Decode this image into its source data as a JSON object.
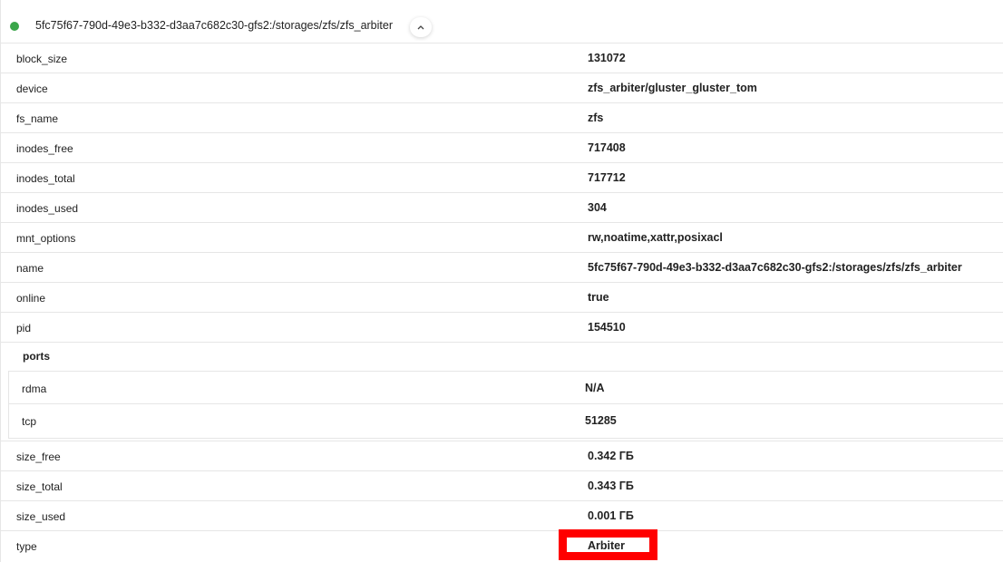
{
  "header": {
    "title": "5fc75f67-790d-49e3-b332-d3aa7c682c30-gfs2:/storages/zfs/zfs_arbiter",
    "status_color": "#3aa64a",
    "collapse_icon": "chevron-up-icon"
  },
  "rows": [
    {
      "key": "block_size",
      "value": "131072"
    },
    {
      "key": "device",
      "value": "zfs_arbiter/gluster_gluster_tom"
    },
    {
      "key": "fs_name",
      "value": "zfs"
    },
    {
      "key": "inodes_free",
      "value": "717408"
    },
    {
      "key": "inodes_total",
      "value": "717712"
    },
    {
      "key": "inodes_used",
      "value": "304"
    },
    {
      "key": "mnt_options",
      "value": "rw,noatime,xattr,posixacl"
    },
    {
      "key": "name",
      "value": "5fc75f67-790d-49e3-b332-d3aa7c682c30-gfs2:/storages/zfs/zfs_arbiter"
    },
    {
      "key": "online",
      "value": "true"
    },
    {
      "key": "pid",
      "value": "154510"
    }
  ],
  "ports": {
    "title": "ports",
    "rows": [
      {
        "key": "rdma",
        "value": "N/A"
      },
      {
        "key": "tcp",
        "value": "51285"
      }
    ]
  },
  "rows_after": [
    {
      "key": "size_free",
      "value": "0.342 ГБ"
    },
    {
      "key": "size_total",
      "value": "0.343 ГБ"
    },
    {
      "key": "size_used",
      "value": "0.001 ГБ"
    },
    {
      "key": "type",
      "value": "Arbiter"
    }
  ],
  "highlight_color": "#ff0000"
}
